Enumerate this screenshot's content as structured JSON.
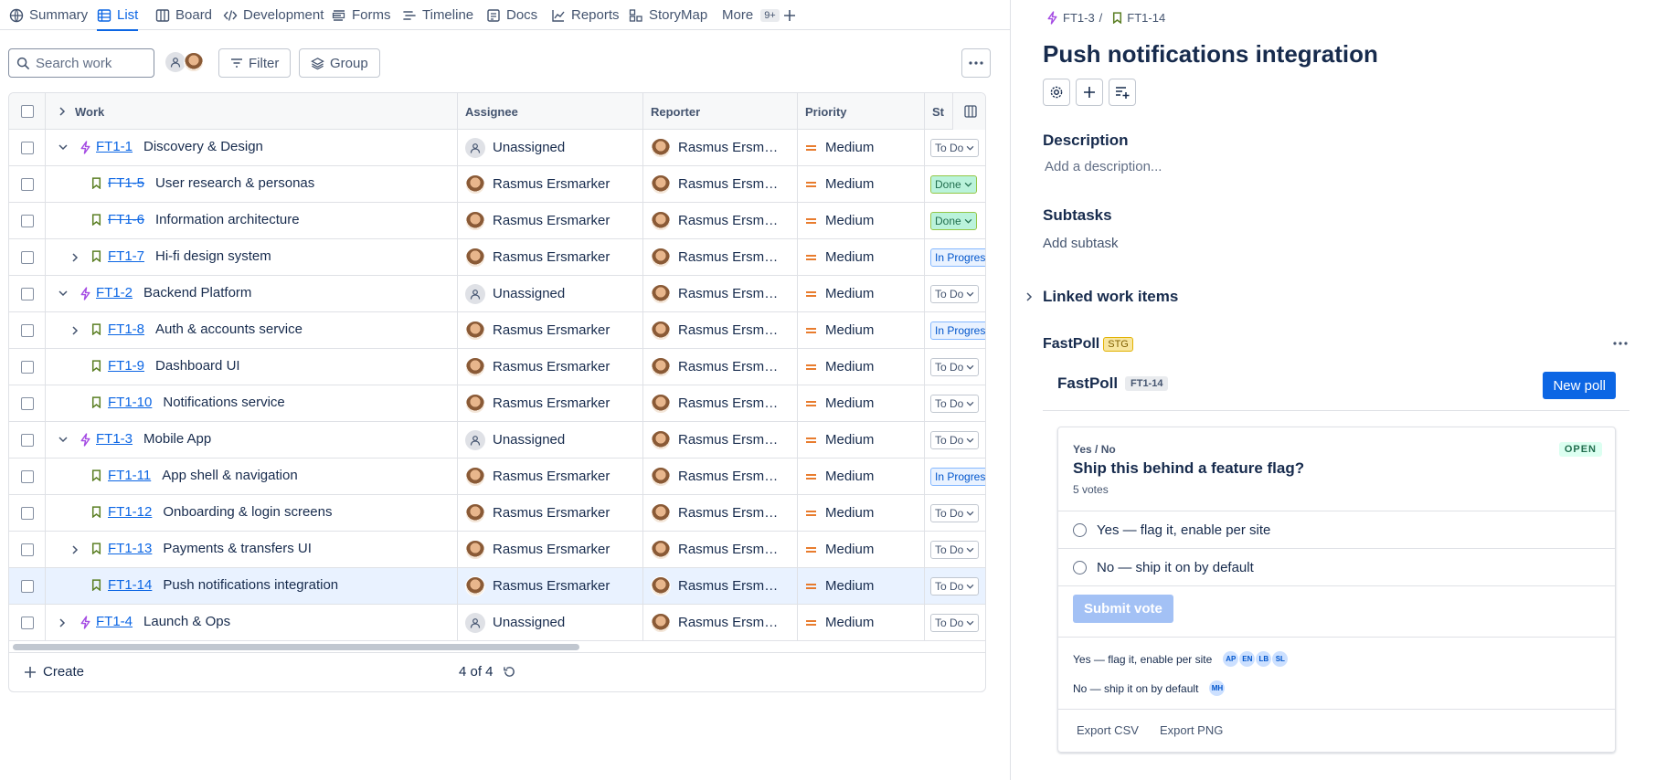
{
  "nav": {
    "tabs": [
      {
        "label": "Summary",
        "icon": "globe-icon"
      },
      {
        "label": "List",
        "icon": "list-icon",
        "active": true
      },
      {
        "label": "Board",
        "icon": "board-icon"
      },
      {
        "label": "Development",
        "icon": "code-icon"
      },
      {
        "label": "Forms",
        "icon": "forms-icon"
      },
      {
        "label": "Timeline",
        "icon": "timeline-icon"
      },
      {
        "label": "Docs",
        "icon": "docs-icon"
      },
      {
        "label": "Reports",
        "icon": "reports-icon"
      },
      {
        "label": "StoryMap",
        "icon": "storymap-icon"
      },
      {
        "label": "More",
        "icon": ""
      }
    ],
    "more_count": "9+",
    "accent": "#0c66e4"
  },
  "toolbar": {
    "search_placeholder": "Search work",
    "filter_label": "Filter",
    "group_label": "Group"
  },
  "table": {
    "columns": [
      "Work",
      "Assignee",
      "Reporter",
      "Priority",
      "St"
    ],
    "rows": [
      {
        "key": "FT1-1",
        "summary": "Discovery & Design",
        "type": "epic",
        "indent": 0,
        "expander": "expanded",
        "done": false,
        "assignee": "Unassigned",
        "reporter": "Rasmus Ersmarker",
        "priority": "Medium",
        "status": "To Do",
        "status_kind": "todo"
      },
      {
        "key": "FT1-5",
        "summary": "User research & personas",
        "type": "story",
        "indent": 1,
        "expander": "none",
        "done": true,
        "assignee": "Rasmus Ersmarker",
        "reporter": "Rasmus Ersmarker",
        "priority": "Medium",
        "status": "Done",
        "status_kind": "done"
      },
      {
        "key": "FT1-6",
        "summary": "Information architecture",
        "type": "story",
        "indent": 1,
        "expander": "none",
        "done": true,
        "assignee": "Rasmus Ersmarker",
        "reporter": "Rasmus Ersmarker",
        "priority": "Medium",
        "status": "Done",
        "status_kind": "done"
      },
      {
        "key": "FT1-7",
        "summary": "Hi-fi design system",
        "type": "story",
        "indent": 1,
        "expander": "collapsed",
        "done": false,
        "assignee": "Rasmus Ersmarker",
        "reporter": "Rasmus Ersmarker",
        "priority": "Medium",
        "status": "In Progress",
        "status_kind": "prog"
      },
      {
        "key": "FT1-2",
        "summary": "Backend Platform",
        "type": "epic",
        "indent": 0,
        "expander": "expanded",
        "done": false,
        "assignee": "Unassigned",
        "reporter": "Rasmus Ersmarker",
        "priority": "Medium",
        "status": "To Do",
        "status_kind": "todo"
      },
      {
        "key": "FT1-8",
        "summary": "Auth & accounts service",
        "type": "story",
        "indent": 1,
        "expander": "collapsed",
        "done": false,
        "assignee": "Rasmus Ersmarker",
        "reporter": "Rasmus Ersmarker",
        "priority": "Medium",
        "status": "In Progress",
        "status_kind": "prog"
      },
      {
        "key": "FT1-9",
        "summary": "Dashboard UI",
        "type": "story",
        "indent": 1,
        "expander": "none",
        "done": false,
        "assignee": "Rasmus Ersmarker",
        "reporter": "Rasmus Ersmarker",
        "priority": "Medium",
        "status": "To Do",
        "status_kind": "todo"
      },
      {
        "key": "FT1-10",
        "summary": "Notifications service",
        "type": "story",
        "indent": 1,
        "expander": "none",
        "done": false,
        "assignee": "Rasmus Ersmarker",
        "reporter": "Rasmus Ersmarker",
        "priority": "Medium",
        "status": "To Do",
        "status_kind": "todo"
      },
      {
        "key": "FT1-3",
        "summary": "Mobile App",
        "type": "epic",
        "indent": 0,
        "expander": "expanded",
        "done": false,
        "assignee": "Unassigned",
        "reporter": "Rasmus Ersmarker",
        "priority": "Medium",
        "status": "To Do",
        "status_kind": "todo"
      },
      {
        "key": "FT1-11",
        "summary": "App shell & navigation",
        "type": "story",
        "indent": 1,
        "expander": "none",
        "done": false,
        "assignee": "Rasmus Ersmarker",
        "reporter": "Rasmus Ersmarker",
        "priority": "Medium",
        "status": "In Progress",
        "status_kind": "prog"
      },
      {
        "key": "FT1-12",
        "summary": "Onboarding & login screens",
        "type": "story",
        "indent": 1,
        "expander": "none",
        "done": false,
        "assignee": "Rasmus Ersmarker",
        "reporter": "Rasmus Ersmarker",
        "priority": "Medium",
        "status": "To Do",
        "status_kind": "todo"
      },
      {
        "key": "FT1-13",
        "summary": "Payments & transfers UI",
        "type": "story",
        "indent": 1,
        "expander": "collapsed",
        "done": false,
        "assignee": "Rasmus Ersmarker",
        "reporter": "Rasmus Ersmarker",
        "priority": "Medium",
        "status": "To Do",
        "status_kind": "todo"
      },
      {
        "key": "FT1-14",
        "summary": "Push notifications integration",
        "type": "story",
        "indent": 1,
        "expander": "none",
        "done": false,
        "selected": true,
        "assignee": "Rasmus Ersmarker",
        "reporter": "Rasmus Ersmarker",
        "priority": "Medium",
        "status": "To Do",
        "status_kind": "todo"
      },
      {
        "key": "FT1-4",
        "summary": "Launch & Ops",
        "type": "epic",
        "indent": 0,
        "expander": "collapsed",
        "done": false,
        "assignee": "Unassigned",
        "reporter": "Rasmus Ersmarker",
        "priority": "Medium",
        "status": "To Do",
        "status_kind": "todo"
      }
    ],
    "create_label": "Create",
    "pagination": "4 of 4"
  },
  "panel": {
    "breadcrumb_parent": "FT1-3",
    "breadcrumb_sep": "/",
    "breadcrumb_current": "FT1-14",
    "title": "Push notifications integration",
    "description_heading": "Description",
    "description_placeholder": "Add a description...",
    "subtasks_heading": "Subtasks",
    "add_subtask": "Add subtask",
    "linked_heading": "Linked work items",
    "app_name": "FastPoll",
    "app_badge": "STG",
    "fastpoll": {
      "title": "FastPoll",
      "issue_key": "FT1-14",
      "new_poll_label": "New poll",
      "poll": {
        "kind": "Yes / No",
        "question": "Ship this behind a feature flag?",
        "votes": "5 votes",
        "state": "OPEN",
        "options": [
          "Yes — flag it, enable per site",
          "No — ship it on by default"
        ],
        "submit_label": "Submit vote",
        "results": [
          {
            "label": "Yes — flag it, enable per site",
            "voters": [
              "AP",
              "EN",
              "LB",
              "SL"
            ]
          },
          {
            "label": "No — ship it on by default",
            "voters": [
              "MH"
            ]
          }
        ],
        "export_csv": "Export CSV",
        "export_png": "Export PNG"
      }
    }
  }
}
